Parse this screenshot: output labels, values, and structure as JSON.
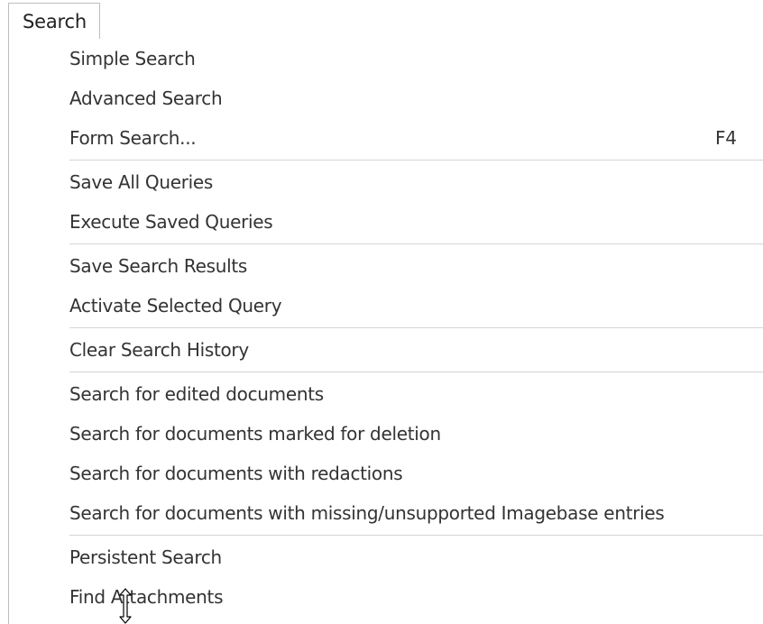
{
  "menu_bar": {
    "tab_label": "Search"
  },
  "menu": {
    "groups": [
      [
        {
          "label": "Simple Search",
          "shortcut": ""
        },
        {
          "label": "Advanced Search",
          "shortcut": ""
        },
        {
          "label": "Form Search...",
          "shortcut": "F4"
        }
      ],
      [
        {
          "label": "Save All Queries",
          "shortcut": ""
        },
        {
          "label": "Execute Saved Queries",
          "shortcut": ""
        }
      ],
      [
        {
          "label": "Save Search Results",
          "shortcut": ""
        },
        {
          "label": "Activate Selected Query",
          "shortcut": ""
        }
      ],
      [
        {
          "label": "Clear Search History",
          "shortcut": ""
        }
      ],
      [
        {
          "label": "Search for edited documents",
          "shortcut": ""
        },
        {
          "label": "Search for documents marked for deletion",
          "shortcut": ""
        },
        {
          "label": "Search for documents with redactions",
          "shortcut": ""
        },
        {
          "label": "Search for documents with missing/unsupported Imagebase entries",
          "shortcut": ""
        }
      ],
      [
        {
          "label": "Persistent Search",
          "shortcut": ""
        },
        {
          "label": "Find Attachments",
          "shortcut": ""
        }
      ]
    ]
  },
  "cursor": {
    "icon": "resize-vertical-cursor-icon"
  }
}
